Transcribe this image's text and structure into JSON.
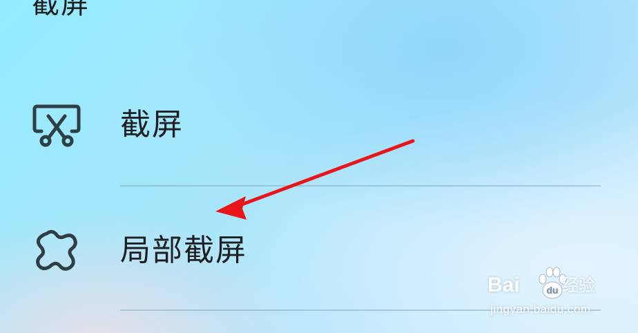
{
  "section": {
    "title": "截屏"
  },
  "menu": {
    "items": [
      {
        "label": "截屏",
        "icon": "screenshot-scissors-icon"
      },
      {
        "label": "局部截屏",
        "icon": "partial-screenshot-icon"
      }
    ]
  },
  "annotation": {
    "arrow_color": "#e8161a"
  },
  "watermark": {
    "logo_text": "Bai",
    "logo_suffix": "经验",
    "url": "jingyan.baidu.com"
  }
}
